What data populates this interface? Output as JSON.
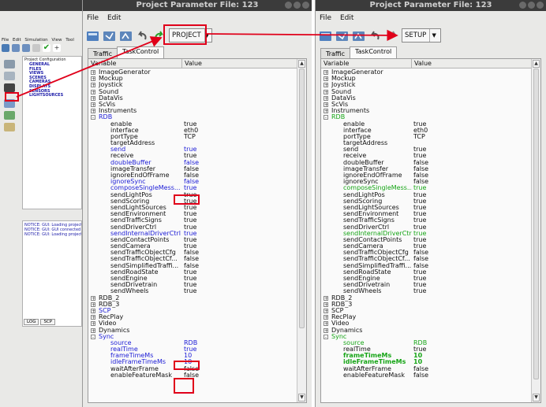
{
  "background_window": {
    "menu": [
      "File",
      "Edit",
      "Simulation",
      "View",
      "Tool"
    ],
    "config_title": "Project Configuration",
    "config_items": [
      "GENERAL",
      "FILES",
      "VIEWS",
      "SCENES",
      "CAMERAS",
      "DISPLAYS",
      "SENSORS",
      "LIGHTSOURCES"
    ],
    "log_lines": [
      "NOTICE:  GUI: Loading project",
      "NOTICE:  GUI: GUI connected",
      "NOTICE:  GUI: Loading project"
    ],
    "log_tabs": [
      "LOG",
      "SCP"
    ]
  },
  "windows": [
    {
      "title": "Project Parameter File: 123",
      "menu": [
        "File",
        "Edit"
      ],
      "combo": "PROJECT",
      "tabs": [
        "Traffic",
        "TaskControl"
      ],
      "col_variable": "Variable",
      "col_value": "Value"
    },
    {
      "title": "Project Parameter File: 123",
      "menu": [
        "File",
        "Edit"
      ],
      "combo": "SETUP",
      "tabs": [
        "Traffic",
        "TaskControl"
      ],
      "col_variable": "Variable",
      "col_value": "Value"
    }
  ],
  "tree_left": [
    {
      "l": 1,
      "e": "+",
      "t": "ImageGenerator",
      "v": "",
      "c": "black"
    },
    {
      "l": 1,
      "e": "+",
      "t": "Mockup",
      "v": "",
      "c": "black"
    },
    {
      "l": 1,
      "e": "+",
      "t": "Joystick",
      "v": "",
      "c": "black"
    },
    {
      "l": 1,
      "e": "+",
      "t": "Sound",
      "v": "",
      "c": "black"
    },
    {
      "l": 1,
      "e": "+",
      "t": "DataVis",
      "v": "",
      "c": "black"
    },
    {
      "l": 1,
      "e": "+",
      "t": "ScVis",
      "v": "",
      "c": "black"
    },
    {
      "l": 1,
      "e": "+",
      "t": "Instruments",
      "v": "",
      "c": "black"
    },
    {
      "l": 1,
      "e": "-",
      "t": "RDB",
      "v": "",
      "c": "blue"
    },
    {
      "l": 2,
      "e": "",
      "t": "enable",
      "v": "true",
      "c": "black"
    },
    {
      "l": 2,
      "e": "",
      "t": "interface",
      "v": "eth0",
      "c": "black"
    },
    {
      "l": 2,
      "e": "",
      "t": "portType",
      "v": "TCP",
      "c": "black"
    },
    {
      "l": 2,
      "e": "",
      "t": "targetAddress",
      "v": "",
      "c": "black"
    },
    {
      "l": 2,
      "e": "",
      "t": "send",
      "v": "true",
      "c": "blue"
    },
    {
      "l": 2,
      "e": "",
      "t": "receive",
      "v": "true",
      "c": "black"
    },
    {
      "l": 2,
      "e": "",
      "t": "doubleBuffer",
      "v": "false",
      "c": "blue"
    },
    {
      "l": 2,
      "e": "",
      "t": "imageTransfer",
      "v": "false",
      "c": "black"
    },
    {
      "l": 2,
      "e": "",
      "t": "ignoreEndOfFrame",
      "v": "false",
      "c": "black"
    },
    {
      "l": 2,
      "e": "",
      "t": "ignoreSync",
      "v": "false",
      "c": "blue"
    },
    {
      "l": 2,
      "e": "",
      "t": "composeSingleMess...",
      "v": "true",
      "c": "blue"
    },
    {
      "l": 2,
      "e": "",
      "t": "sendLightPos",
      "v": "true",
      "c": "black"
    },
    {
      "l": 2,
      "e": "",
      "t": "sendScoring",
      "v": "true",
      "c": "black"
    },
    {
      "l": 2,
      "e": "",
      "t": "sendLightSources",
      "v": "true",
      "c": "black"
    },
    {
      "l": 2,
      "e": "",
      "t": "sendEnvironment",
      "v": "true",
      "c": "black"
    },
    {
      "l": 2,
      "e": "",
      "t": "sendTrafficSigns",
      "v": "true",
      "c": "black"
    },
    {
      "l": 2,
      "e": "",
      "t": "sendDriverCtrl",
      "v": "true",
      "c": "black"
    },
    {
      "l": 2,
      "e": "",
      "t": "sendInternalDriverCtrl",
      "v": "true",
      "c": "blue"
    },
    {
      "l": 2,
      "e": "",
      "t": "sendContactPoints",
      "v": "true",
      "c": "black"
    },
    {
      "l": 2,
      "e": "",
      "t": "sendCamera",
      "v": "true",
      "c": "black"
    },
    {
      "l": 2,
      "e": "",
      "t": "sendTrafficObjectCfg",
      "v": "false",
      "c": "black"
    },
    {
      "l": 2,
      "e": "",
      "t": "sendTrafficObjectCf...",
      "v": "false",
      "c": "black"
    },
    {
      "l": 2,
      "e": "",
      "t": "sendSimplifiedTraffi...",
      "v": "false",
      "c": "black"
    },
    {
      "l": 2,
      "e": "",
      "t": "sendRoadState",
      "v": "true",
      "c": "black"
    },
    {
      "l": 2,
      "e": "",
      "t": "sendEngine",
      "v": "true",
      "c": "black"
    },
    {
      "l": 2,
      "e": "",
      "t": "sendDrivetrain",
      "v": "true",
      "c": "black"
    },
    {
      "l": 2,
      "e": "",
      "t": "sendWheels",
      "v": "true",
      "c": "black"
    },
    {
      "l": 1,
      "e": "+",
      "t": "RDB_2",
      "v": "",
      "c": "black"
    },
    {
      "l": 1,
      "e": "+",
      "t": "RDB_3",
      "v": "",
      "c": "black"
    },
    {
      "l": 1,
      "e": "+",
      "t": "SCP",
      "v": "",
      "c": "blue"
    },
    {
      "l": 1,
      "e": "+",
      "t": "RecPlay",
      "v": "",
      "c": "black"
    },
    {
      "l": 1,
      "e": "+",
      "t": "Video",
      "v": "",
      "c": "black"
    },
    {
      "l": 1,
      "e": "+",
      "t": "Dynamics",
      "v": "",
      "c": "black"
    },
    {
      "l": 1,
      "e": "-",
      "t": "Sync",
      "v": "",
      "c": "blue"
    },
    {
      "l": 2,
      "e": "",
      "t": "source",
      "v": "RDB",
      "c": "blue"
    },
    {
      "l": 2,
      "e": "",
      "t": "realTime",
      "v": "true",
      "c": "blue"
    },
    {
      "l": 2,
      "e": "",
      "t": "frameTimeMs",
      "v": "10",
      "c": "blue"
    },
    {
      "l": 2,
      "e": "",
      "t": "idleFrameTimeMs",
      "v": "10",
      "c": "blue"
    },
    {
      "l": 2,
      "e": "",
      "t": "waitAfterFrame",
      "v": "false",
      "c": "black"
    },
    {
      "l": 2,
      "e": "",
      "t": "enableFeatureMask",
      "v": "false",
      "c": "black"
    }
  ],
  "tree_right": [
    {
      "l": 1,
      "e": "+",
      "t": "ImageGenerator",
      "v": "",
      "c": "black"
    },
    {
      "l": 1,
      "e": "+",
      "t": "Mockup",
      "v": "",
      "c": "black"
    },
    {
      "l": 1,
      "e": "+",
      "t": "Joystick",
      "v": "",
      "c": "black"
    },
    {
      "l": 1,
      "e": "+",
      "t": "Sound",
      "v": "",
      "c": "black"
    },
    {
      "l": 1,
      "e": "+",
      "t": "DataVis",
      "v": "",
      "c": "black"
    },
    {
      "l": 1,
      "e": "+",
      "t": "ScVis",
      "v": "",
      "c": "black"
    },
    {
      "l": 1,
      "e": "+",
      "t": "Instruments",
      "v": "",
      "c": "black"
    },
    {
      "l": 1,
      "e": "-",
      "t": "RDB",
      "v": "",
      "c": "green"
    },
    {
      "l": 2,
      "e": "",
      "t": "enable",
      "v": "true",
      "c": "black"
    },
    {
      "l": 2,
      "e": "",
      "t": "interface",
      "v": "eth0",
      "c": "black"
    },
    {
      "l": 2,
      "e": "",
      "t": "portType",
      "v": "TCP",
      "c": "black"
    },
    {
      "l": 2,
      "e": "",
      "t": "targetAddress",
      "v": "",
      "c": "black"
    },
    {
      "l": 2,
      "e": "",
      "t": "send",
      "v": "true",
      "c": "black"
    },
    {
      "l": 2,
      "e": "",
      "t": "receive",
      "v": "true",
      "c": "black"
    },
    {
      "l": 2,
      "e": "",
      "t": "doubleBuffer",
      "v": "false",
      "c": "black"
    },
    {
      "l": 2,
      "e": "",
      "t": "imageTransfer",
      "v": "false",
      "c": "black"
    },
    {
      "l": 2,
      "e": "",
      "t": "ignoreEndOfFrame",
      "v": "false",
      "c": "black"
    },
    {
      "l": 2,
      "e": "",
      "t": "ignoreSync",
      "v": "false",
      "c": "black"
    },
    {
      "l": 2,
      "e": "",
      "t": "composeSingleMess...",
      "v": "true",
      "c": "green"
    },
    {
      "l": 2,
      "e": "",
      "t": "sendLightPos",
      "v": "true",
      "c": "black"
    },
    {
      "l": 2,
      "e": "",
      "t": "sendScoring",
      "v": "true",
      "c": "black"
    },
    {
      "l": 2,
      "e": "",
      "t": "sendLightSources",
      "v": "true",
      "c": "black"
    },
    {
      "l": 2,
      "e": "",
      "t": "sendEnvironment",
      "v": "true",
      "c": "black"
    },
    {
      "l": 2,
      "e": "",
      "t": "sendTrafficSigns",
      "v": "true",
      "c": "black"
    },
    {
      "l": 2,
      "e": "",
      "t": "sendDriverCtrl",
      "v": "true",
      "c": "black"
    },
    {
      "l": 2,
      "e": "",
      "t": "sendInternalDriverCtrl",
      "v": "true",
      "c": "green"
    },
    {
      "l": 2,
      "e": "",
      "t": "sendContactPoints",
      "v": "true",
      "c": "black"
    },
    {
      "l": 2,
      "e": "",
      "t": "sendCamera",
      "v": "true",
      "c": "black"
    },
    {
      "l": 2,
      "e": "",
      "t": "sendTrafficObjectCfg",
      "v": "false",
      "c": "black"
    },
    {
      "l": 2,
      "e": "",
      "t": "sendTrafficObjectCf...",
      "v": "false",
      "c": "black"
    },
    {
      "l": 2,
      "e": "",
      "t": "sendSimplifiedTraffi...",
      "v": "false",
      "c": "black"
    },
    {
      "l": 2,
      "e": "",
      "t": "sendRoadState",
      "v": "true",
      "c": "black"
    },
    {
      "l": 2,
      "e": "",
      "t": "sendEngine",
      "v": "true",
      "c": "black"
    },
    {
      "l": 2,
      "e": "",
      "t": "sendDrivetrain",
      "v": "true",
      "c": "black"
    },
    {
      "l": 2,
      "e": "",
      "t": "sendWheels",
      "v": "true",
      "c": "black"
    },
    {
      "l": 1,
      "e": "+",
      "t": "RDB_2",
      "v": "",
      "c": "black"
    },
    {
      "l": 1,
      "e": "+",
      "t": "RDB_3",
      "v": "",
      "c": "black"
    },
    {
      "l": 1,
      "e": "+",
      "t": "SCP",
      "v": "",
      "c": "black"
    },
    {
      "l": 1,
      "e": "+",
      "t": "RecPlay",
      "v": "",
      "c": "black"
    },
    {
      "l": 1,
      "e": "+",
      "t": "Video",
      "v": "",
      "c": "black"
    },
    {
      "l": 1,
      "e": "+",
      "t": "Dynamics",
      "v": "",
      "c": "black"
    },
    {
      "l": 1,
      "e": "-",
      "t": "Sync",
      "v": "",
      "c": "green"
    },
    {
      "l": 2,
      "e": "",
      "t": "source",
      "v": "RDB",
      "c": "green"
    },
    {
      "l": 2,
      "e": "",
      "t": "realTime",
      "v": "true",
      "c": "black"
    },
    {
      "l": 2,
      "e": "",
      "t": "frameTimeMs",
      "v": "10",
      "c": "green-bold"
    },
    {
      "l": 2,
      "e": "",
      "t": "idleFrameTimeMs",
      "v": "10",
      "c": "green-bold"
    },
    {
      "l": 2,
      "e": "",
      "t": "waitAfterFrame",
      "v": "false",
      "c": "black"
    },
    {
      "l": 2,
      "e": "",
      "t": "enableFeatureMask",
      "v": "false",
      "c": "black"
    }
  ],
  "colors": {
    "highlight": "#e0001a",
    "modified_blue": "#1c1cd6",
    "modified_green": "#16a516",
    "titlebar": "#3b3b3b"
  },
  "icons": [
    "new-file-icon",
    "open-file-icon",
    "save-file-icon",
    "undo-icon",
    "redo-icon"
  ]
}
